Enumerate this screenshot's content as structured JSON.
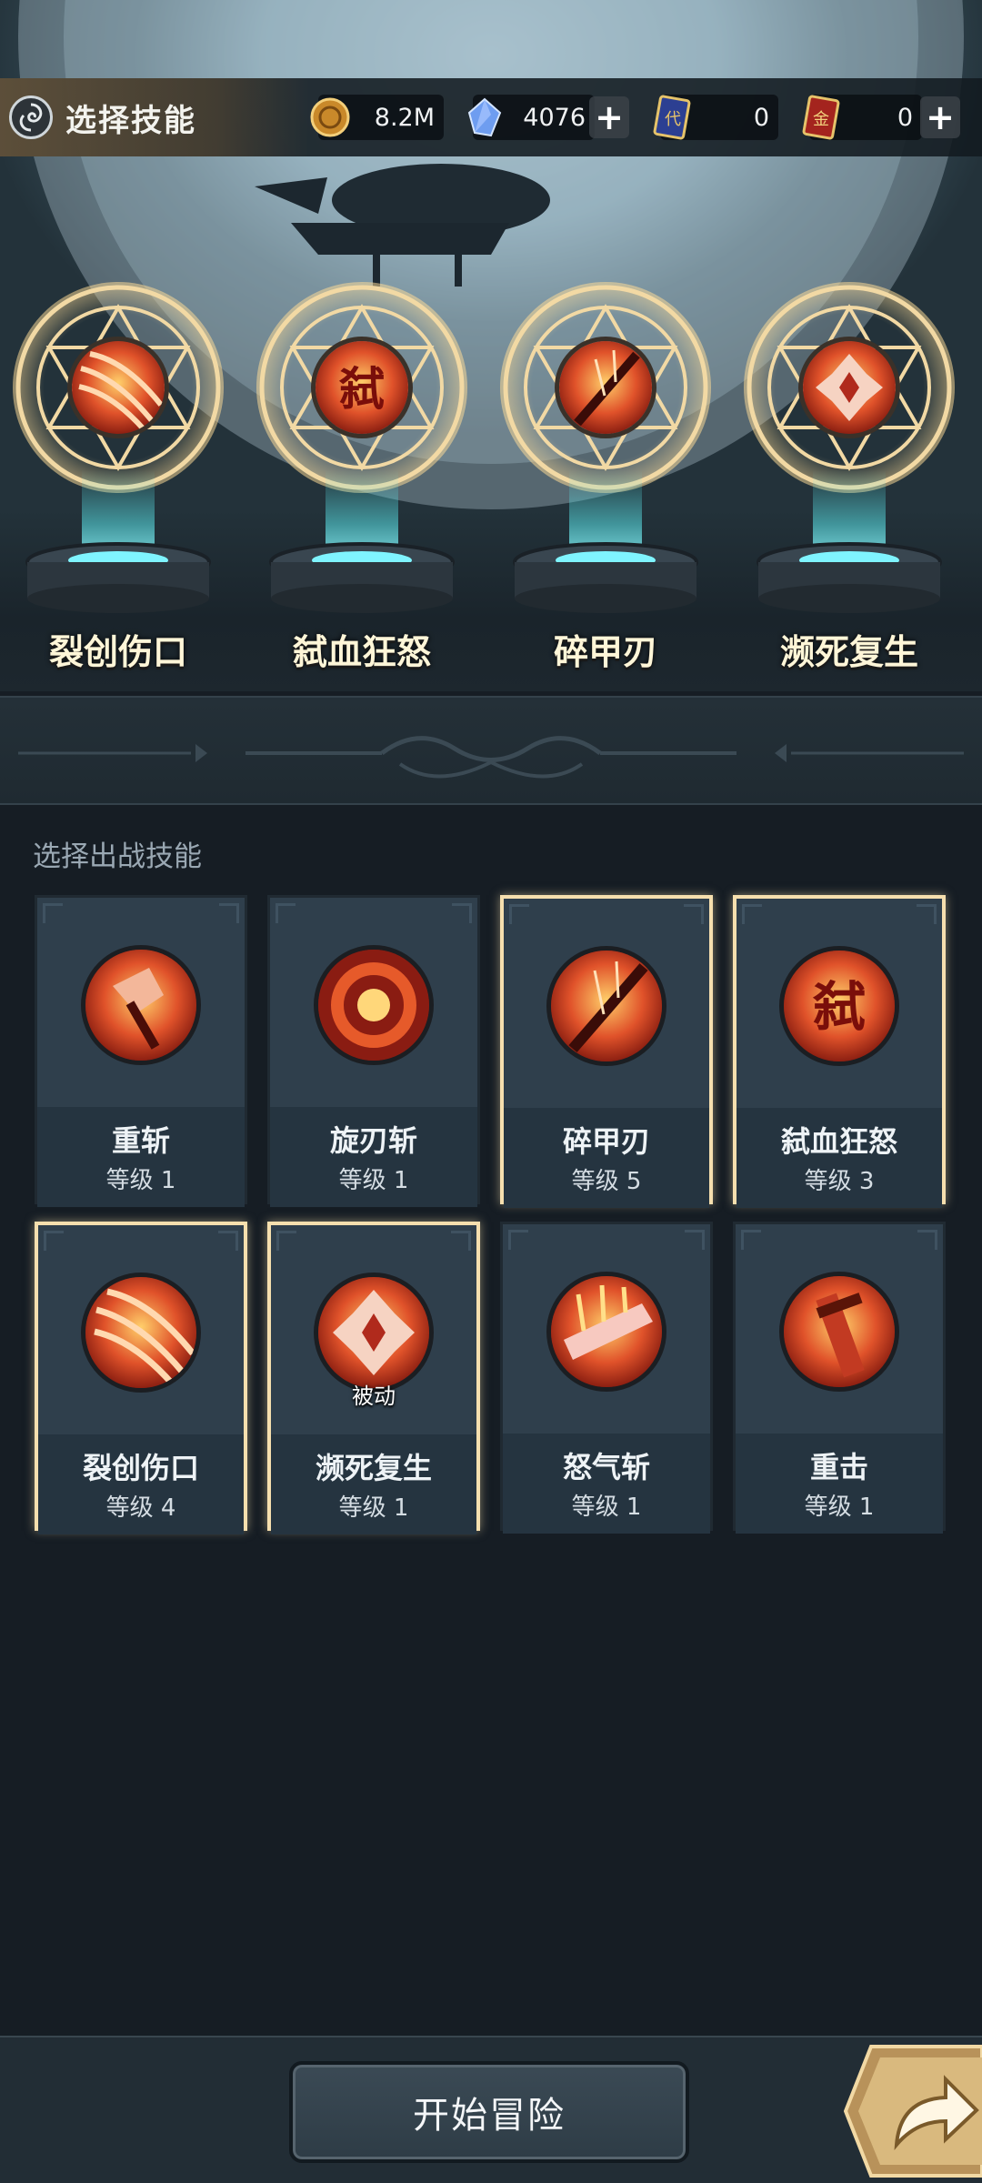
{
  "header": {
    "title": "选择技能",
    "resources": [
      {
        "icon": "coin-icon",
        "value": "8.2M"
      },
      {
        "icon": "crystal-icon",
        "value": "4076"
      },
      {
        "icon": "ticket-card-icon",
        "value": "0"
      },
      {
        "icon": "gold-card-icon",
        "value": "0"
      }
    ]
  },
  "equipped": [
    {
      "name": "裂创伤口",
      "icon": "claw-slash-icon"
    },
    {
      "name": "弑血狂怒",
      "icon": "blood-rage-icon"
    },
    {
      "name": "碎甲刃",
      "icon": "armor-break-blade-icon"
    },
    {
      "name": "濒死复生",
      "icon": "revive-icon"
    }
  ],
  "section": {
    "title": "选择出战技能"
  },
  "skills": [
    {
      "name": "重斩",
      "level": "等级 1",
      "selected": false,
      "icon": "axe-chop-icon"
    },
    {
      "name": "旋刃斩",
      "level": "等级 1",
      "selected": false,
      "icon": "spin-blade-icon"
    },
    {
      "name": "碎甲刃",
      "level": "等级 5",
      "selected": true,
      "icon": "armor-break-blade-icon"
    },
    {
      "name": "弑血狂怒",
      "level": "等级 3",
      "selected": true,
      "icon": "blood-rage-icon"
    },
    {
      "name": "裂创伤口",
      "level": "等级 4",
      "selected": true,
      "icon": "claw-slash-icon"
    },
    {
      "name": "濒死复生",
      "level": "等级 1",
      "selected": true,
      "icon": "revive-icon",
      "tag": "被动"
    },
    {
      "name": "怒气斩",
      "level": "等级 1",
      "selected": false,
      "icon": "rage-slash-icon"
    },
    {
      "name": "重击",
      "level": "等级 1",
      "selected": false,
      "icon": "heavy-strike-icon"
    }
  ],
  "footer": {
    "start_label": "开始冒险"
  },
  "colors": {
    "gold_border": "#f6dfae",
    "card_bg": "#2c3b47",
    "beam": "#5ae6eb"
  }
}
